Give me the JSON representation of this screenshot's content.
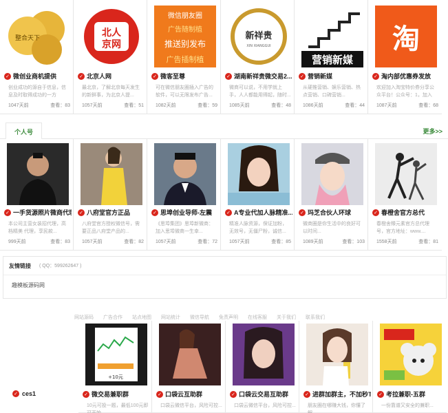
{
  "row1": [
    {
      "title": "微创业商机提供",
      "desc": "创业成功的源自于信息，信息及时取得成功的一方",
      "days": "1047天前",
      "views": "查看：83"
    },
    {
      "title": "北京人网",
      "desc": "最北京，了解北京每天发生的新鲜事，为北京人提...",
      "days": "1057天前",
      "views": "查看：51"
    },
    {
      "title": "微客至尊",
      "desc": "可在微信朋友圈插入广告的软件，可以无限发布广告...",
      "days": "1082天前",
      "views": "查看：59"
    },
    {
      "title": "湖南新祥贵微交易2...",
      "desc": "微商可以说，不用学就上手，人人都能用得起，随时...",
      "days": "1085天前",
      "views": "查看：48"
    },
    {
      "title": "营销新媒",
      "desc": "从硬推营销、娱乐营销、热点营销、口碑营销...",
      "days": "1086天前",
      "views": "查看：44"
    },
    {
      "title": "淘内部优惠券发放",
      "desc": "欢迎加入淘宝特价券分享公众平台！公众号：1，加入千...",
      "days": "1087天前",
      "views": "查看：68"
    }
  ],
  "section_personal": {
    "tab": "个人号",
    "more": "更多>>"
  },
  "row2": [
    {
      "title": "一手货源照片微商代理",
      "desc": "本公司主营女装招代理，高档精美 代理，享民款...",
      "days": "999天前",
      "views": "查看：83"
    },
    {
      "title": "八府堂官方正品",
      "desc": "八府堂官方授权微信号，需要正品八府堂产品的...",
      "days": "1057天前",
      "views": "查看：82"
    },
    {
      "title": "思埠创业导师-左震",
      "desc": "《思埠集团》思埠新微商：加入思埠微商一生幸...",
      "days": "1057天前",
      "views": "查看：72"
    },
    {
      "title": "A专业代加人脉精准...",
      "desc": "精准人脉资源，保证加粉，无效号，无僵尸粉，诚信...",
      "days": "1057天前",
      "views": "查看：85"
    },
    {
      "title": "玛芝合伙人环球",
      "desc": "微商圈是你生活中的良好可以时间...",
      "days": "1089天前",
      "views": "查看：103"
    },
    {
      "title": "春橙舍官方总代",
      "desc": "春橙舍臻元素官方总代理号，官方地址：www....",
      "days": "1558天前",
      "views": "查看：81"
    }
  ],
  "links": {
    "heading": "友情链接",
    "qq": "( QQ：599262647 )",
    "item": "趣模板源码网"
  },
  "footer_nav": [
    "网站源码",
    "广告合作",
    "站点地图",
    "网站统计",
    "微信导航",
    "免责声明",
    "在线客服",
    "关于我们",
    "联系我们"
  ],
  "row3": [
    {
      "title": "微交易兼职群",
      "desc": "10元可投一题，最低100元即可开始..."
    },
    {
      "title": "口袋云互助群",
      "desc": "口袋云微信平台，风险可控..."
    },
    {
      "title": "口袋云交易互助群",
      "desc": "口袋云微信平台，风险可控..."
    },
    {
      "title": "进群加群主，不加秒T",
      "desc": "朋友圈在哪赚大钱，你懂了解..."
    },
    {
      "title": "考拉兼职-五群",
      "desc": "一份靠谱又安全的兼职..."
    }
  ],
  "ces_label": "ces1",
  "colors": {
    "accent_green": "#3a8a3a",
    "check_red": "#d9261c",
    "border": "#e6e6e6"
  }
}
